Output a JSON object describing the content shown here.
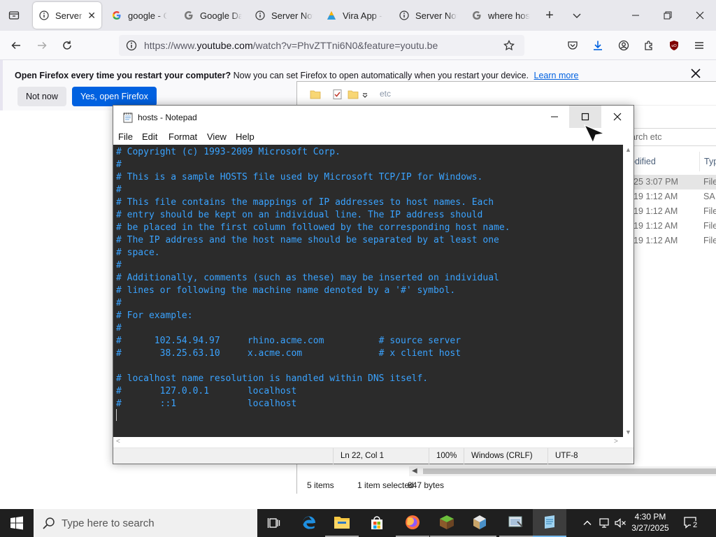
{
  "browser": {
    "tabs": [
      {
        "label": "Server Not",
        "icon": "info-icon",
        "active": true
      },
      {
        "label": "google - Go",
        "icon": "google-icon"
      },
      {
        "label": "Google Data",
        "icon": "google-icon"
      },
      {
        "label": "Server Not",
        "icon": "info-icon"
      },
      {
        "label": "Vira App -",
        "icon": "vira-icon"
      },
      {
        "label": "Server Not",
        "icon": "info-icon"
      },
      {
        "label": "where host",
        "icon": "google-icon"
      }
    ],
    "close_tab_glyph": "✕",
    "new_tab_glyph": "+",
    "url": {
      "prefix": "https://www.",
      "host": "youtube.com",
      "path": "/watch?v=PhvZTTni6N0&feature=youtu.be"
    },
    "notification": {
      "bold": "Open Firefox every time you restart your computer?",
      "text": "Now you can set Firefox to open automatically when you restart your device.",
      "link": "Learn more",
      "not_now": "Not now",
      "open": "Yes, open Firefox"
    }
  },
  "explorer": {
    "path_text": "etc",
    "search_placeholder": "arch etc",
    "columns": [
      "odified",
      "Typ"
    ],
    "rows": [
      {
        "date": "25 3:07 PM",
        "type": "File",
        "selected": true
      },
      {
        "date": "19 1:12 AM",
        "type": "SA"
      },
      {
        "date": "19 1:12 AM",
        "type": "File"
      },
      {
        "date": "19 1:12 AM",
        "type": "File"
      },
      {
        "date": "19 1:12 AM",
        "type": "File"
      }
    ],
    "status": {
      "items": "5 items",
      "selected": "1 item selected",
      "size": "847 bytes"
    }
  },
  "notepad": {
    "title": "hosts - Notepad",
    "menu": [
      "File",
      "Edit",
      "Format",
      "View",
      "Help"
    ],
    "content": "# Copyright (c) 1993-2009 Microsoft Corp.\n#\n# This is a sample HOSTS file used by Microsoft TCP/IP for Windows.\n#\n# This file contains the mappings of IP addresses to host names. Each\n# entry should be kept on an individual line. The IP address should\n# be placed in the first column followed by the corresponding host name.\n# The IP address and the host name should be separated by at least one\n# space.\n#\n# Additionally, comments (such as these) may be inserted on individual\n# lines or following the machine name denoted by a '#' symbol.\n#\n# For example:\n#\n#      102.54.94.97     rhino.acme.com          # source server\n#       38.25.63.10     x.acme.com              # x client host\n\n# localhost name resolution is handled within DNS itself.\n#       127.0.0.1       localhost\n#       ::1             localhost\n",
    "status": {
      "position": "Ln 22, Col 1",
      "zoom": "100%",
      "line_endings": "Windows (CRLF)",
      "encoding": "UTF-8"
    }
  },
  "taskbar": {
    "search_placeholder": "Type here to search",
    "time": "4:30 PM",
    "date": "3/27/2025",
    "notification_count": "2"
  },
  "colors": {
    "firefox_accent": "#0061e0",
    "notepad_bg": "#2b2b2b",
    "notepad_text": "#3aa3ff",
    "taskbar": "#1f1f1f"
  }
}
